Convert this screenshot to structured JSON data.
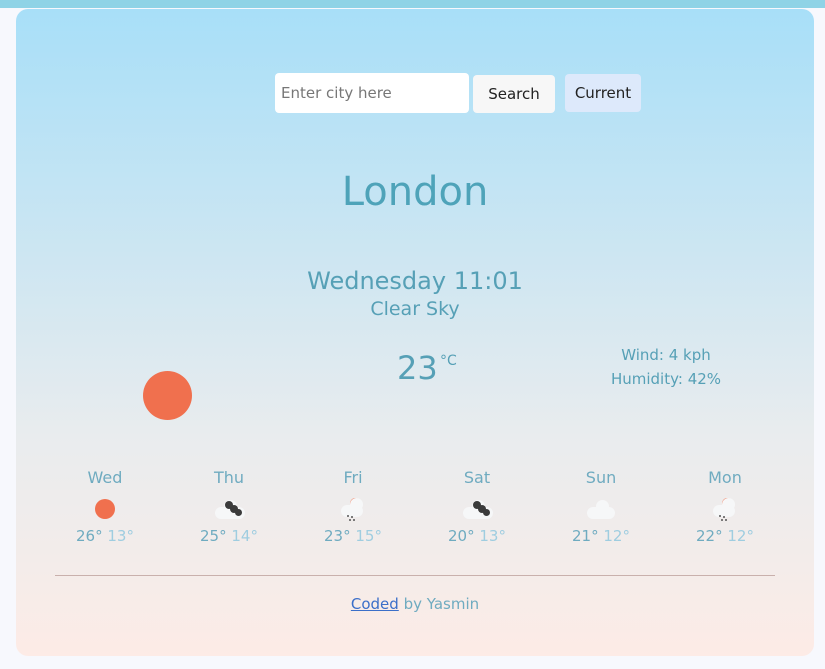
{
  "search": {
    "placeholder": "Enter city here",
    "value": "",
    "button_label": "Search"
  },
  "current_button_label": "Current",
  "weather": {
    "city": "London",
    "day_time": "Wednesday 11:01",
    "description": "Clear Sky",
    "icon": "sun-icon",
    "temperature": "23",
    "unit": "°C",
    "wind": "Wind: 4 kph",
    "humidity": "Humidity: 42%"
  },
  "forecast": [
    {
      "day": "Wed",
      "max": "26°",
      "min": "13°",
      "icon": "sun-icon"
    },
    {
      "day": "Thu",
      "max": "25°",
      "min": "14°",
      "icon": "broken-clouds-icon"
    },
    {
      "day": "Fri",
      "max": "23°",
      "min": "15°",
      "icon": "rain-icon"
    },
    {
      "day": "Sat",
      "max": "20°",
      "min": "13°",
      "icon": "broken-clouds-icon"
    },
    {
      "day": "Sun",
      "max": "21°",
      "min": "12°",
      "icon": "cloud-icon"
    },
    {
      "day": "Mon",
      "max": "22°",
      "min": "12°",
      "icon": "rain-icon"
    }
  ],
  "footer": {
    "link_text": "Coded",
    "text": " by Yasmin"
  },
  "colors": {
    "accent": "#56a0b6",
    "sun": "#f0704e",
    "link": "#3b6fc9"
  }
}
